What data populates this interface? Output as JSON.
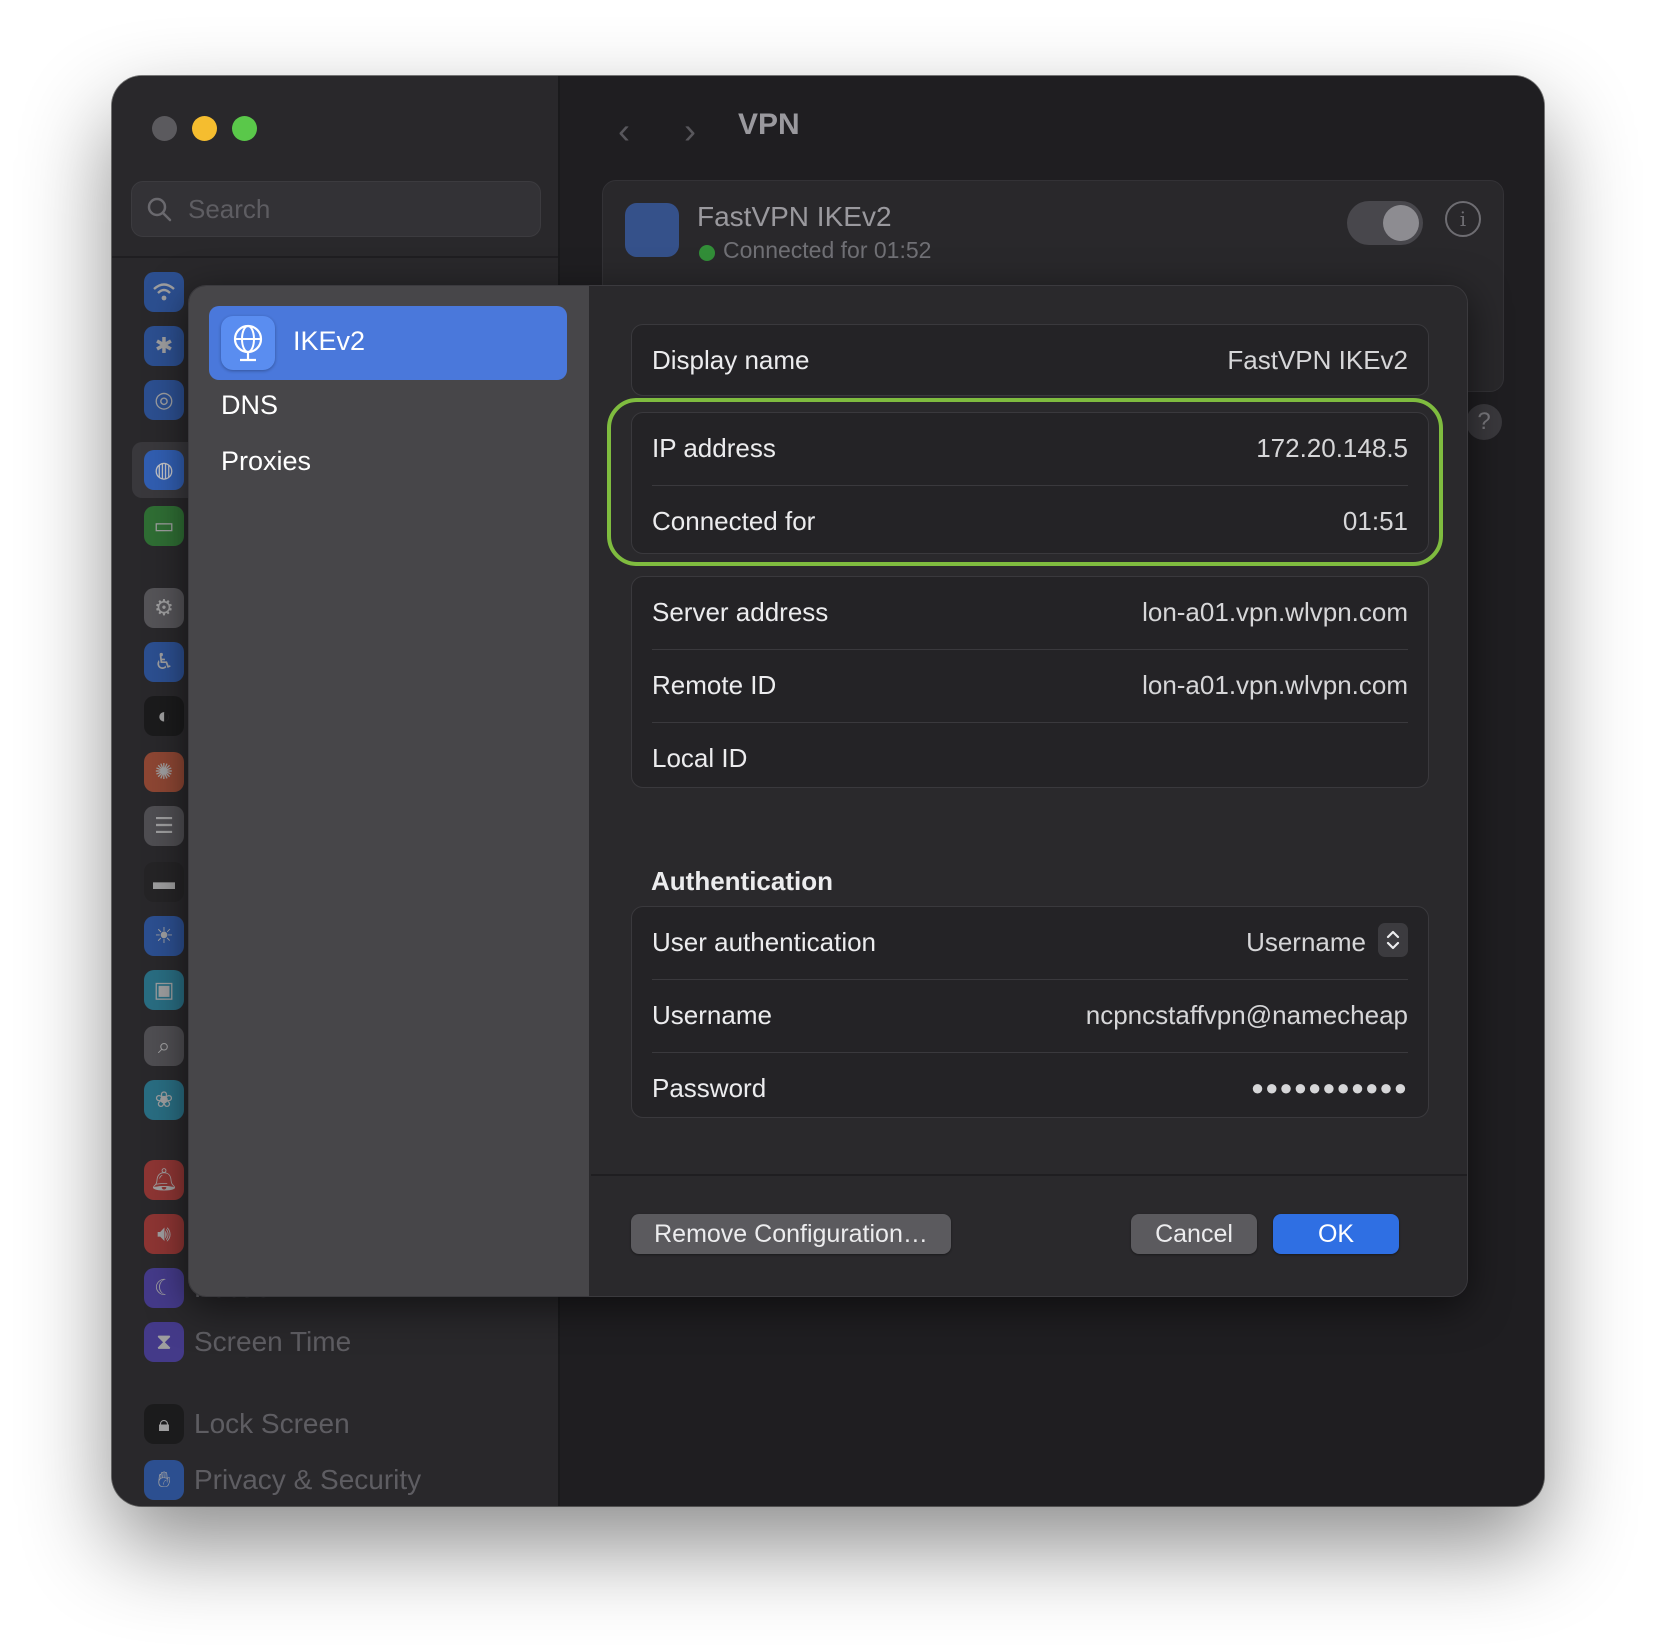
{
  "window": {
    "search_placeholder": "Search",
    "title": "VPN"
  },
  "sidebar_bg": {
    "visible_labels": [
      "Focus",
      "Screen Time",
      "Lock Screen",
      "Privacy & Security"
    ]
  },
  "vpn_card": {
    "name": "FastVPN IKEv2",
    "status": "Connected for 01:52",
    "toggle_on": true
  },
  "sheet": {
    "sidebar": [
      {
        "label": "IKEv2",
        "selected": true
      },
      {
        "label": "DNS",
        "selected": false
      },
      {
        "label": "Proxies",
        "selected": false
      }
    ],
    "general": {
      "display_name_label": "Display name",
      "display_name_value": "FastVPN IKEv2"
    },
    "connection": {
      "ip_label": "IP address",
      "ip_value": "172.20.148.5",
      "connected_label": "Connected for",
      "connected_value": "01:51"
    },
    "server": {
      "server_label": "Server address",
      "server_value": "lon-a01.vpn.wlvpn.com",
      "remote_label": "Remote ID",
      "remote_value": "lon-a01.vpn.wlvpn.com",
      "local_label": "Local ID",
      "local_value": ""
    },
    "auth": {
      "title": "Authentication",
      "user_auth_label": "User authentication",
      "user_auth_value": "Username",
      "username_label": "Username",
      "username_value": "ncpncstaffvpn@namecheap",
      "password_label": "Password",
      "password_value": "●●●●●●●●●●●"
    },
    "buttons": {
      "remove": "Remove Configuration…",
      "cancel": "Cancel",
      "ok": "OK"
    }
  },
  "colors": {
    "accent": "#2f6fe3",
    "selection": "#4a78db",
    "highlight_ring": "#7fbc3f",
    "status_green": "#34a83c"
  }
}
